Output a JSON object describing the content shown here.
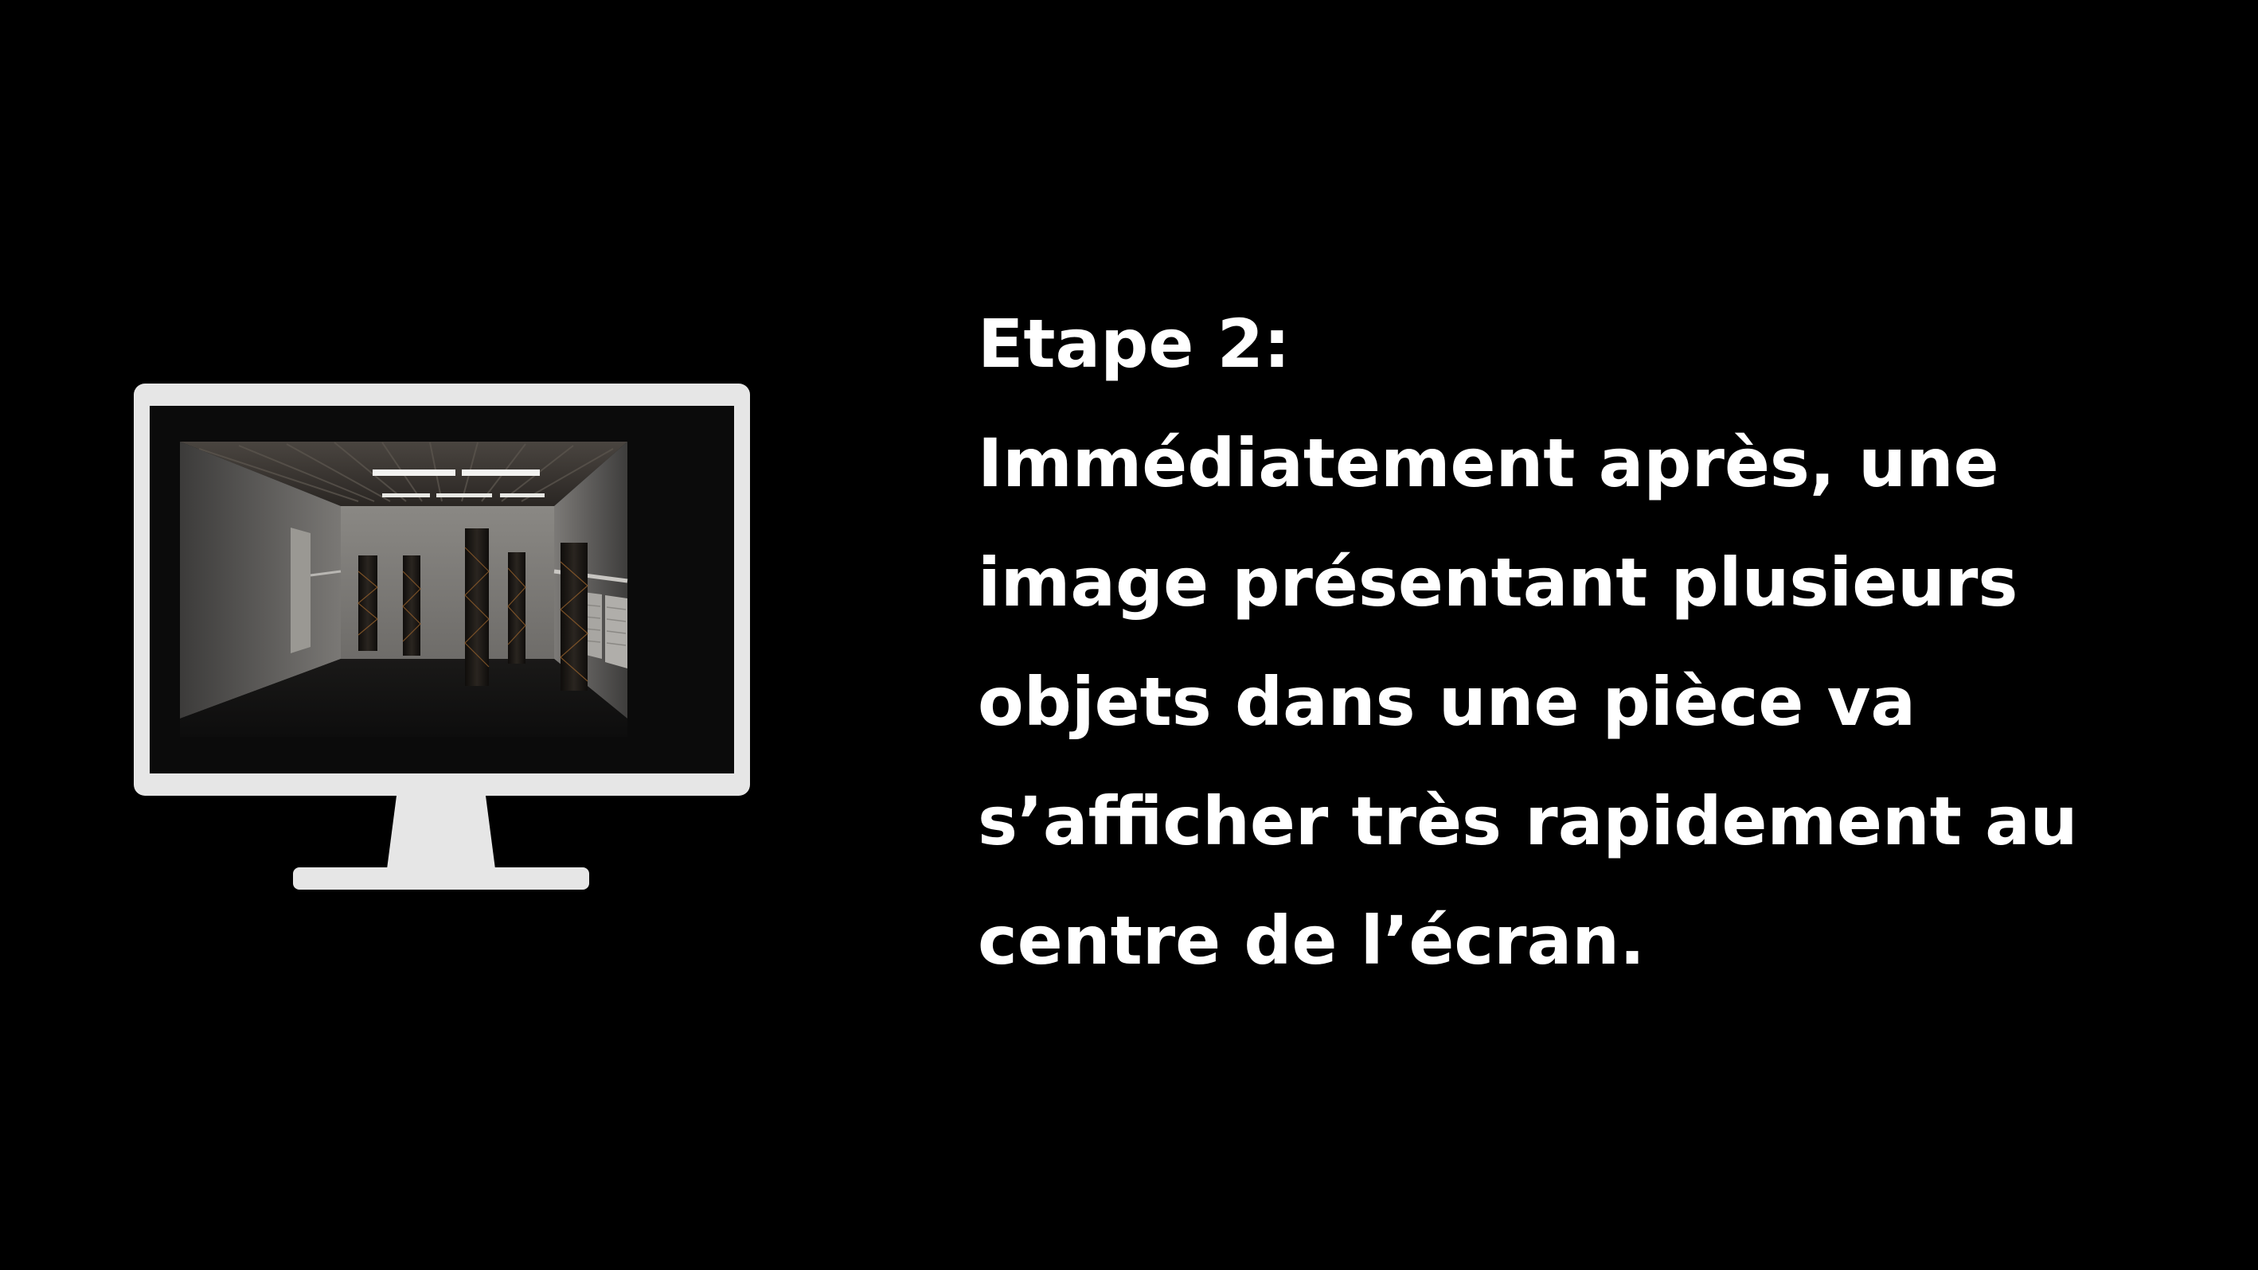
{
  "slide": {
    "step_title": "Etape 2:",
    "body_lines": [
      "Immédiatement après, une",
      "image présentant plusieurs",
      "objets dans une pièce va",
      "s’afficher très rapidement au",
      "centre de l’écran."
    ]
  },
  "monitor": {
    "icon": "monitor-icon",
    "screen_content": "room-with-pillars-image",
    "frame_color": "#e6e6e6"
  },
  "colors": {
    "background": "#000000",
    "text": "#ffffff"
  }
}
